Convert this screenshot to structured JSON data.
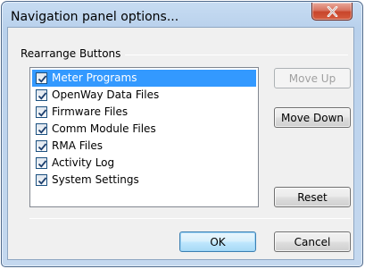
{
  "window": {
    "title": "Navigation panel options..."
  },
  "group": {
    "label": "Rearrange Buttons"
  },
  "list": {
    "items": [
      {
        "label": "Meter Programs",
        "checked": true,
        "selected": true
      },
      {
        "label": "OpenWay Data Files",
        "checked": true,
        "selected": false
      },
      {
        "label": "Firmware Files",
        "checked": true,
        "selected": false
      },
      {
        "label": "Comm Module Files",
        "checked": true,
        "selected": false
      },
      {
        "label": "RMA Files",
        "checked": true,
        "selected": false
      },
      {
        "label": "Activity Log",
        "checked": true,
        "selected": false
      },
      {
        "label": "System Settings",
        "checked": true,
        "selected": false
      }
    ]
  },
  "buttons": {
    "move_up": "Move Up",
    "move_down": "Move Down",
    "reset": "Reset",
    "ok": "OK",
    "cancel": "Cancel"
  },
  "colors": {
    "selection": "#3399ff",
    "titlebar": "#b9d1ec",
    "close": "#c8452b"
  }
}
